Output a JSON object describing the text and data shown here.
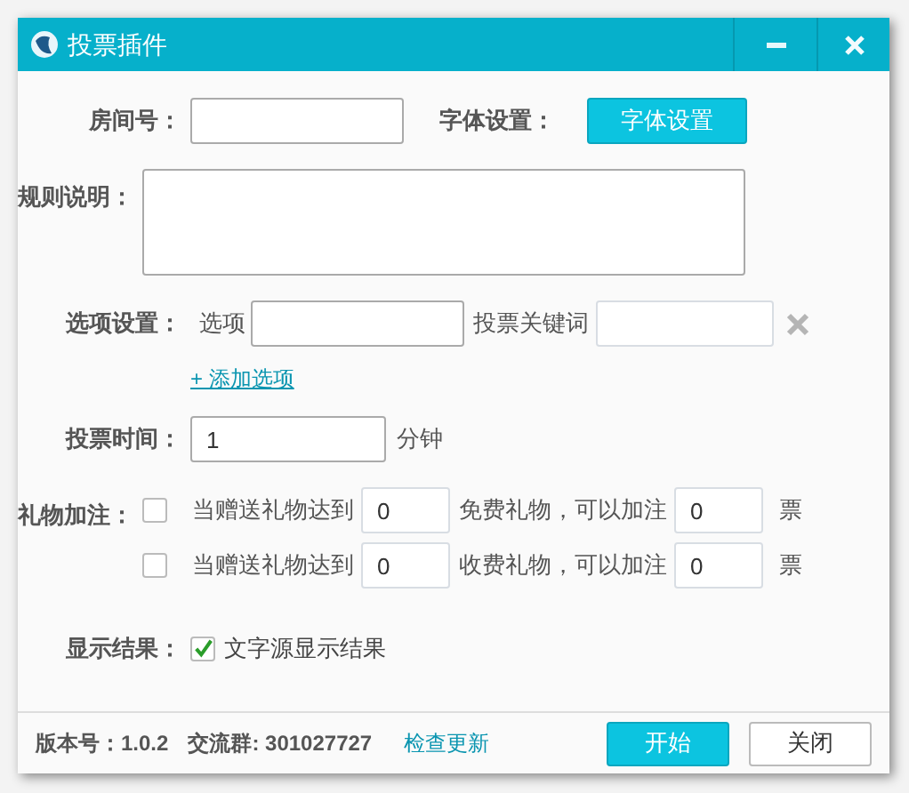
{
  "window": {
    "title": "投票插件"
  },
  "room": {
    "label": "房间号："
  },
  "font_setting": {
    "label": "字体设置：",
    "button": "字体设置"
  },
  "rules": {
    "label": "规则说明："
  },
  "options": {
    "label": "选项设置：",
    "option_label": "选项",
    "keyword_label": "投票关键词",
    "add_link": "+ 添加选项"
  },
  "vote_time": {
    "label": "投票时间：",
    "value": "1",
    "unit": "分钟"
  },
  "gift_bonus": {
    "label": "礼物加注：",
    "rows": [
      {
        "checked": false,
        "prefix": "当赠送礼物达到",
        "amount": "0",
        "middle": "免费礼物，可以加注",
        "votes": "0",
        "suffix": "票"
      },
      {
        "checked": false,
        "prefix": "当赠送礼物达到",
        "amount": "0",
        "middle": "收费礼物，可以加注",
        "votes": "0",
        "suffix": "票"
      }
    ]
  },
  "display_result": {
    "label": "显示结果：",
    "checked": true,
    "text": "文字源显示结果"
  },
  "footer": {
    "version": "版本号：1.0.2",
    "group": "交流群: 301027727",
    "update_link": "检查更新",
    "buttons": [
      {
        "label": "开始",
        "kind": "primary"
      },
      {
        "label": "关闭",
        "kind": "secondary"
      }
    ]
  }
}
